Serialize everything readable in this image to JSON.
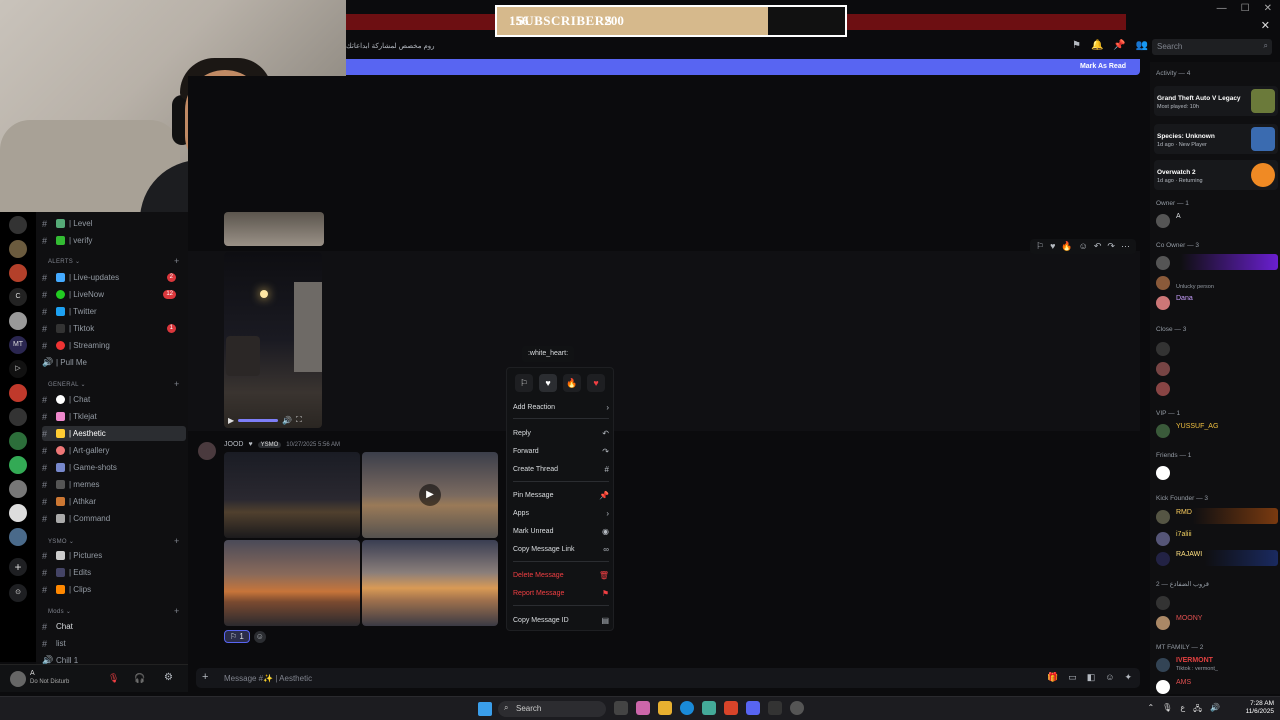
{
  "subscribers": {
    "current": "156",
    "label": "SUBSCRIBERS",
    "goal": "200",
    "progress_fraction": 0.78
  },
  "header": {
    "channel_description": "روم مخصص لمشاركة ابداعاتك",
    "search_placeholder": "Search"
  },
  "banner": {
    "mark_as_read": "Mark As Read"
  },
  "channels": {
    "top": [
      {
        "name": "| Level"
      },
      {
        "name": "| verify"
      }
    ],
    "alerts_label": "ALERTS",
    "alerts": [
      {
        "name": "| Live-updates",
        "badge": "2"
      },
      {
        "name": "| LiveNow",
        "badge": "12"
      },
      {
        "name": "| Twitter",
        "badge": ""
      },
      {
        "name": "| Tiktok",
        "badge": "1"
      },
      {
        "name": "| Streaming",
        "badge": ""
      },
      {
        "name": "| Pull Me",
        "badge": ""
      }
    ],
    "general_label": "GENERAL",
    "general": [
      {
        "name": "| Chat"
      },
      {
        "name": "| Tklejat"
      },
      {
        "name": "| Aesthetic"
      },
      {
        "name": "| Art-gallery"
      },
      {
        "name": "| Game-shots"
      },
      {
        "name": "| memes"
      },
      {
        "name": "| Athkar"
      },
      {
        "name": "| Command"
      }
    ],
    "ysmo_label": "YSMO",
    "ysmo": [
      {
        "name": "| Pictures"
      },
      {
        "name": "| Edits"
      },
      {
        "name": "| Clips"
      }
    ],
    "mods_label": "Mods",
    "mods": [
      {
        "name": "Chat"
      },
      {
        "name": "list"
      },
      {
        "name": "Chill 1"
      }
    ]
  },
  "user": {
    "name": "A",
    "status": "Do Not Disturb"
  },
  "message2": {
    "author": "JOOD",
    "tag": "YSMO",
    "timestamp": "10/27/2025 5:56 AM",
    "reaction_count": "1"
  },
  "tooltip": ":white_heart:",
  "context_menu": {
    "items": [
      "Add Reaction",
      "Reply",
      "Forward",
      "Create Thread",
      "Pin Message",
      "Apps",
      "Mark Unread",
      "Copy Message Link",
      "Delete Message",
      "Report Message",
      "Copy Message ID"
    ]
  },
  "composer": {
    "placeholder": "Message #✨ | Aesthetic"
  },
  "members": {
    "activity_header": "Activity — 4",
    "activities": [
      {
        "title": "Grand Theft Auto V Legacy",
        "sub": "Most played: 10h"
      },
      {
        "title": "Species: Unknown",
        "sub": "1d ago · New Player"
      },
      {
        "title": "Overwatch 2",
        "sub": "1d ago · Returning"
      }
    ],
    "groups": [
      {
        "header": "Owner — 1",
        "members": [
          {
            "name": "A",
            "sub": ""
          }
        ]
      },
      {
        "header": "Co Owner — 3",
        "members": [
          {
            "name": "",
            "sub": ""
          },
          {
            "name": "",
            "sub": "Unlucky person"
          },
          {
            "name": "Dana",
            "sub": ""
          }
        ]
      },
      {
        "header": "Close — 3",
        "members": [
          {
            "name": "",
            "sub": ""
          },
          {
            "name": "",
            "sub": ""
          },
          {
            "name": "",
            "sub": ""
          }
        ]
      },
      {
        "header": "VIP — 1",
        "members": [
          {
            "name": "YUSSUF_AG",
            "sub": ""
          }
        ]
      },
      {
        "header": "Friends — 1",
        "members": [
          {
            "name": "",
            "sub": ""
          }
        ]
      },
      {
        "header": "Kick Founder — 3",
        "members": [
          {
            "name": "RMD",
            "sub": ""
          },
          {
            "name": "i7aliii",
            "sub": ""
          },
          {
            "name": "RAJAWI",
            "sub": ""
          }
        ]
      },
      {
        "header": "قروب الضفادع — 2",
        "members": [
          {
            "name": "",
            "sub": ""
          },
          {
            "name": "MOONY",
            "sub": ""
          }
        ]
      },
      {
        "header": "MT FAMILY — 2",
        "members": [
          {
            "name": "IVERMONT",
            "sub": "Tiktok : vermont_"
          },
          {
            "name": "AMS",
            "sub": ""
          }
        ]
      }
    ]
  },
  "taskbar": {
    "search": "Search",
    "time": "7:28 AM",
    "date": "11/6/2025"
  },
  "colors": {
    "blurple": "#5865f2",
    "danger": "#f23f43",
    "banner_gold": "#d6b98c"
  }
}
